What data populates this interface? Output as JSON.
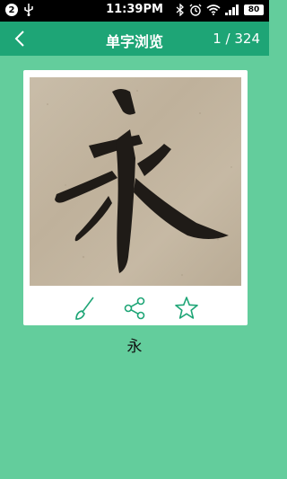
{
  "status_bar": {
    "notification_count": "2",
    "time": "11:39PM",
    "battery": "80"
  },
  "header": {
    "title": "单字浏览",
    "counter": "1 / 324"
  },
  "viewer": {
    "character": "永",
    "actions": [
      "brush-icon",
      "share-icon",
      "star-icon"
    ]
  },
  "colors": {
    "background": "#63cd9c",
    "header": "#1ea576",
    "accent": "#1ea576"
  }
}
